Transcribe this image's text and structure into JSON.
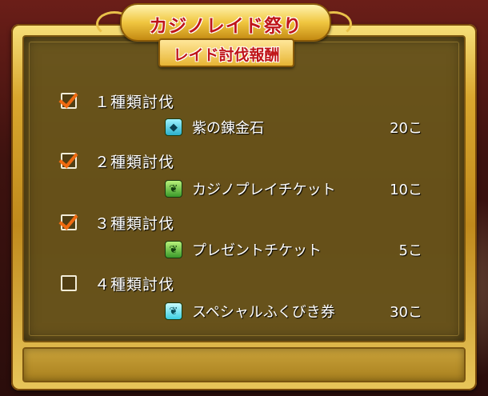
{
  "banner": {
    "title": "カジノレイド祭り",
    "subtitle": "レイド討伐報酬"
  },
  "tiers": [
    {
      "label": "１種類討伐",
      "checked": true,
      "reward": {
        "icon": "alchemy-stone-icon",
        "name": "紫の錬金石",
        "qty": "20こ"
      }
    },
    {
      "label": "２種類討伐",
      "checked": true,
      "reward": {
        "icon": "leaf-ticket-icon",
        "name": "カジノプレイチケット",
        "qty": "10こ"
      }
    },
    {
      "label": "３種類討伐",
      "checked": true,
      "reward": {
        "icon": "leaf-ticket-icon",
        "name": "プレゼントチケット",
        "qty": "5こ"
      }
    },
    {
      "label": "４種類討伐",
      "checked": false,
      "reward": {
        "icon": "feather-ticket-icon",
        "name": "スペシャルふくびき券",
        "qty": "30こ"
      }
    }
  ],
  "colors": {
    "frame_gold": "#d9a72e",
    "panel": "#5f4b19",
    "title_red": "#c0161a",
    "check_orange": "#ef6a10"
  }
}
